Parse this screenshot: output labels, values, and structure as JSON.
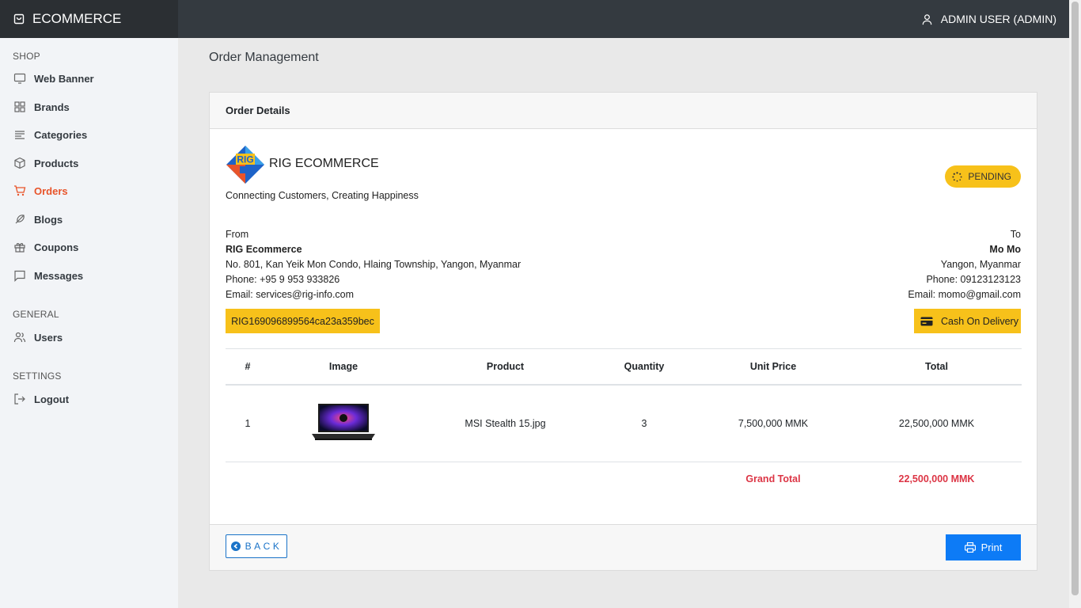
{
  "app": {
    "title": "ECOMMERCE",
    "user": "ADMIN USER (ADMIN)"
  },
  "sidebar": {
    "sections": [
      {
        "label": "SHOP"
      },
      {
        "label": "GENERAL"
      },
      {
        "label": "SETTINGS"
      }
    ],
    "items": [
      {
        "label": "Web Banner",
        "icon": "monitor-icon"
      },
      {
        "label": "Brands",
        "icon": "grid-icon"
      },
      {
        "label": "Categories",
        "icon": "list-icon"
      },
      {
        "label": "Products",
        "icon": "box-icon"
      },
      {
        "label": "Orders",
        "icon": "cart-icon",
        "active": true
      },
      {
        "label": "Blogs",
        "icon": "feather-icon"
      },
      {
        "label": "Coupons",
        "icon": "gift-icon"
      },
      {
        "label": "Messages",
        "icon": "message-icon"
      },
      {
        "label": "Users",
        "icon": "users-icon"
      },
      {
        "label": "Logout",
        "icon": "logout-icon"
      }
    ]
  },
  "page": {
    "title": "Order Management"
  },
  "order": {
    "card_title": "Order Details",
    "company": "RIG ECOMMERCE",
    "tagline": "Connecting Customers, Creating Happiness",
    "status": "PENDING",
    "from": {
      "label": "From",
      "name": "RIG Ecommerce",
      "address": "No. 801, Kan Yeik Mon Condo, Hlaing Township, Yangon, Myanmar",
      "phone": "Phone: +95 9 953 933826",
      "email": "Email: services@rig-info.com"
    },
    "to": {
      "label": "To",
      "name": "Mo Mo",
      "address": "Yangon, Myanmar",
      "phone": "Phone: 09123123123",
      "email": "Email: momo@gmail.com"
    },
    "order_id": "RIG169096899564ca23a359bec",
    "payment": "Cash On Delivery",
    "table": {
      "headers": [
        "#",
        "Image",
        "Product",
        "Quantity",
        "Unit Price",
        "Total"
      ],
      "rows": [
        {
          "no": "1",
          "product": "MSI Stealth 15.jpg",
          "quantity": "3",
          "unit_price": "7,500,000 MMK",
          "total": "22,500,000 MMK"
        }
      ],
      "grand_total_label": "Grand Total",
      "grand_total": "22,500,000 MMK"
    },
    "back_label": "BACK",
    "print_label": "Print"
  },
  "colors": {
    "accent": "#e8542a",
    "badge": "#f7c11a",
    "primary": "#0d7bf6",
    "danger": "#dc3545",
    "topbar": "#343a40"
  }
}
